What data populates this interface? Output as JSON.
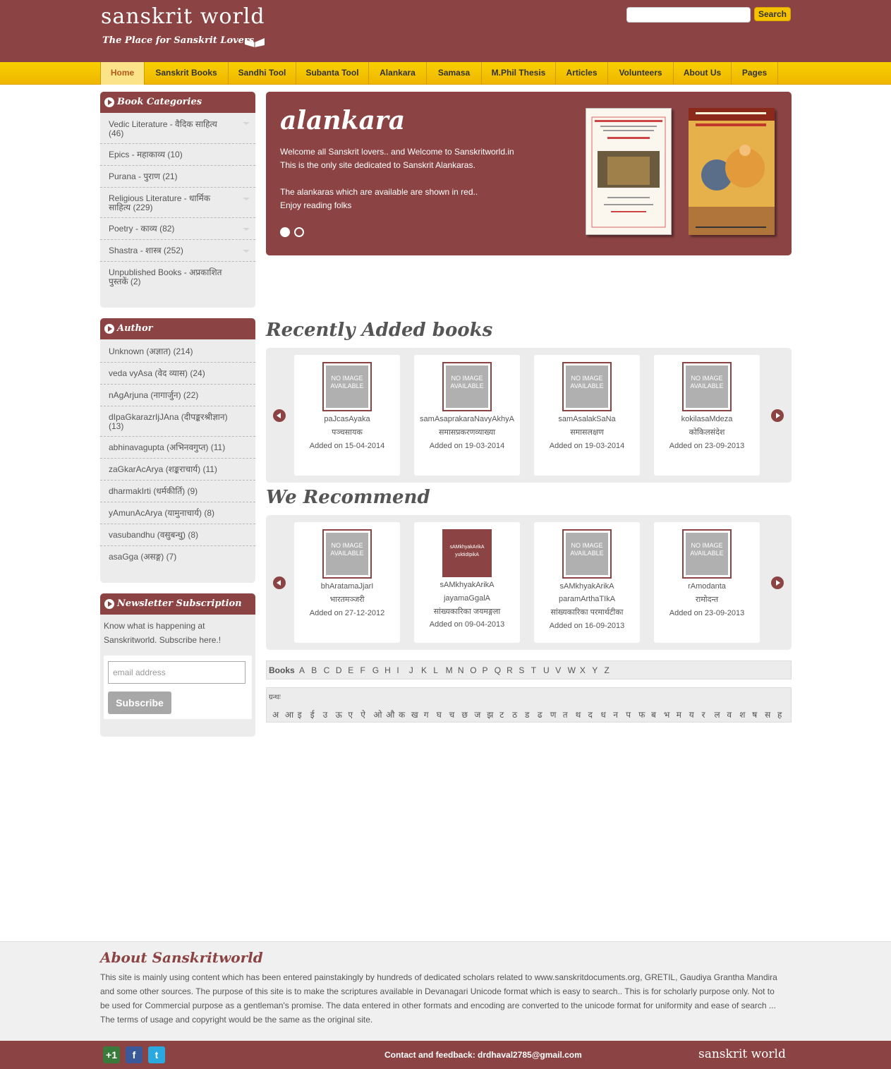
{
  "header": {
    "logo_title": "sanskrit world",
    "logo_tagline": "The Place for Sanskrit Lovers",
    "search_button": "Search"
  },
  "nav": [
    "Home",
    "Sanskrit Books",
    "Sandhi Tool",
    "Subanta Tool",
    "Alankara",
    "Samasa",
    "M.Phil Thesis",
    "Articles",
    "Volunteers",
    "About Us",
    "Pages"
  ],
  "categories": {
    "title": "Book Categories",
    "items": [
      {
        "l1": "Vedic Literature - वैदिक साहित्य",
        "l2": "(46)"
      },
      {
        "l1": "Epics - महाकाव्य (10)",
        "l2": ""
      },
      {
        "l1": "Purana - पुराण (21)",
        "l2": ""
      },
      {
        "l1": "Religious Literature - धार्मिक",
        "l2": "साहित्य (229)"
      },
      {
        "l1": "Poetry - काव्य (82)",
        "l2": ""
      },
      {
        "l1": "Shastra - शास्त्र (252)",
        "l2": ""
      },
      {
        "l1": "Unpublished Books - अप्रकाशित",
        "l2": "पुस्तकें (2)"
      }
    ]
  },
  "authors": {
    "title": "Author",
    "items": [
      {
        "l1": "Unknown (अज्ञात) (214)",
        "l2": ""
      },
      {
        "l1": "veda vyAsa (वेद व्यास) (24)",
        "l2": ""
      },
      {
        "l1": "nAgArjuna (नागार्जुन) (22)",
        "l2": ""
      },
      {
        "l1": "dIpaGkarazrIjJAna (दीपङ्करश्रीज्ञान)",
        "l2": "(13)"
      },
      {
        "l1": "abhinavagupta (अभिनवगुप्त) (11)",
        "l2": ""
      },
      {
        "l1": "zaGkarAcArya (शङ्कराचार्य) (11)",
        "l2": ""
      },
      {
        "l1": "dharmakIrti (धर्मकीर्ति) (9)",
        "l2": ""
      },
      {
        "l1": "yAmunAcArya (यामुनाचार्य) (8)",
        "l2": ""
      },
      {
        "l1": "vasubandhu (वसुबन्धु) (8)",
        "l2": ""
      },
      {
        "l1": "asaGga (असङ्ग) (7)",
        "l2": ""
      }
    ]
  },
  "newsletter": {
    "title": "Newsletter Subscription",
    "text1": "Know what is happening at",
    "text2": "Sanskritworld. Subscribe here.!",
    "email_placeholder": "email address",
    "subscribe": "Subscribe"
  },
  "slider": {
    "title": "alankara",
    "lines": [
      "Welcome all Sanskrit lovers.. and Welcome to Sanskritworld.in",
      "This is the only site dedicated to Sanskrit Alankaras.",
      "The alankaras which are available are shown in red..",
      "Enjoy reading folks"
    ]
  },
  "no_image": "NO IMAGE AVAILABLE",
  "recent": {
    "title": "Recently Added books",
    "books": [
      {
        "t1": "paJcasAyaka",
        "t2": "पञ्चसायक",
        "t3": "",
        "date": "Added on 15-04-2014"
      },
      {
        "t1": "samAsaprakaraNavyAkhyA",
        "t2": "समासप्रकरणव्याख्या",
        "t3": "",
        "date": "Added on 19-03-2014"
      },
      {
        "t1": "samAsalakSaNa",
        "t2": "समासलक्षण",
        "t3": "",
        "date": "Added on 19-03-2014"
      },
      {
        "t1": "kokilasaMdeza",
        "t2": "कोकिलसंदेश",
        "t3": "",
        "date": "Added on 23-09-2013"
      }
    ]
  },
  "recommend": {
    "title": "We Recommend",
    "books": [
      {
        "t1": "bhAratamaJjarI",
        "t2": "भारतमञ्जरी",
        "t3": "",
        "date": "Added on 27-12-2012",
        "cover": ""
      },
      {
        "t1": "sAMkhyakArikA",
        "t2": "jayamaGgalA",
        "t3": "सांख्यकारिका जयमङ्गला",
        "date": "Added on 09-04-2013",
        "cover": "sAMkhyakArikA yuktidIpikA"
      },
      {
        "t1": "sAMkhyakArikA",
        "t2": "paramArthaTIkA",
        "t3": "सांख्यकारिका परमार्थटीका",
        "date": "Added on 16-09-2013",
        "cover": ""
      },
      {
        "t1": "rAmodanta",
        "t2": "रामोदन्त",
        "t3": "",
        "date": "Added on 23-09-2013",
        "cover": ""
      }
    ]
  },
  "alpha": {
    "label": "Books",
    "letters": [
      "A",
      "B",
      "C",
      "D",
      "E",
      "F",
      "G",
      "H",
      "I",
      "J",
      "K",
      "L",
      "M",
      "N",
      "O",
      "P",
      "Q",
      "R",
      "S",
      "T",
      "U",
      "V",
      "W",
      "X",
      "Y",
      "Z"
    ]
  },
  "devanagari": {
    "label": "ग्रन्थः",
    "letters": [
      "अ",
      "आ",
      "इ",
      "ई",
      "उ",
      "ऊ",
      "ए",
      "ऐ",
      "ओ",
      "औ",
      "क",
      "ख",
      "ग",
      "घ",
      "च",
      "छ",
      "ज",
      "झ",
      "ट",
      "ठ",
      "ड",
      "ढ",
      "ण",
      "त",
      "थ",
      "द",
      "ध",
      "न",
      "प",
      "फ",
      "ब",
      "भ",
      "म",
      "य",
      "र",
      "ल",
      "व",
      "श",
      "ष",
      "स",
      "ह"
    ]
  },
  "about": {
    "title": "About Sanskritworld",
    "lines": [
      "This site is mainly using content which has been entered painstakingly by hundreds of dedicated scholars related to www.sanskritdocuments.org, GRETIL, Gaudiya Grantha Mandira",
      "and some other sources. The purpose of this site is to make the scriptures available in Devanagari Unicode format which is easy to search.. This is for scholarly purpose only. Not to",
      "be used for Commercial purpose as a gentleman's promise. The data entered in other formats and encoding are converted to the unicode format for uniformity and ease of search ...",
      "The terms of usage and copyright would be the same as the original site."
    ]
  },
  "footer": {
    "gplus": "+1",
    "facebook": "f",
    "twitter": "t",
    "contact": "Contact and feedback: drdhaval2785@gmail.com",
    "logo": "sanskrit world"
  },
  "colors": {
    "brand": "#8b4443",
    "nav": "#f4c400",
    "panel": "#ececec"
  }
}
